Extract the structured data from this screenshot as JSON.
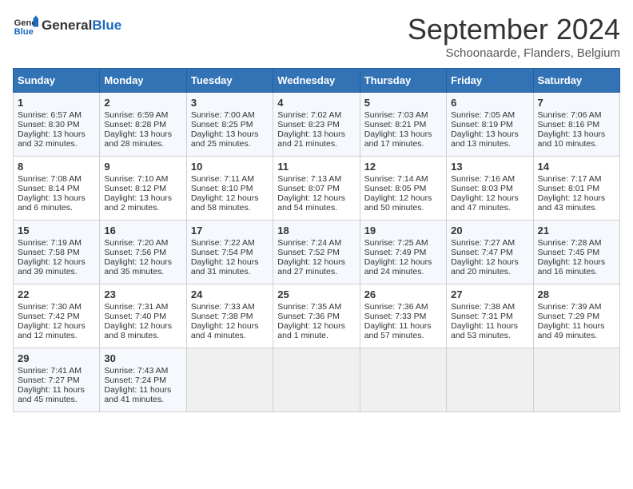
{
  "header": {
    "logo_general": "General",
    "logo_blue": "Blue",
    "month_title": "September 2024",
    "subtitle": "Schoonaarde, Flanders, Belgium"
  },
  "days_of_week": [
    "Sunday",
    "Monday",
    "Tuesday",
    "Wednesday",
    "Thursday",
    "Friday",
    "Saturday"
  ],
  "weeks": [
    [
      {
        "day": 1,
        "sunrise": "Sunrise: 6:57 AM",
        "sunset": "Sunset: 8:30 PM",
        "daylight": "Daylight: 13 hours and 32 minutes."
      },
      {
        "day": 2,
        "sunrise": "Sunrise: 6:59 AM",
        "sunset": "Sunset: 8:28 PM",
        "daylight": "Daylight: 13 hours and 28 minutes."
      },
      {
        "day": 3,
        "sunrise": "Sunrise: 7:00 AM",
        "sunset": "Sunset: 8:25 PM",
        "daylight": "Daylight: 13 hours and 25 minutes."
      },
      {
        "day": 4,
        "sunrise": "Sunrise: 7:02 AM",
        "sunset": "Sunset: 8:23 PM",
        "daylight": "Daylight: 13 hours and 21 minutes."
      },
      {
        "day": 5,
        "sunrise": "Sunrise: 7:03 AM",
        "sunset": "Sunset: 8:21 PM",
        "daylight": "Daylight: 13 hours and 17 minutes."
      },
      {
        "day": 6,
        "sunrise": "Sunrise: 7:05 AM",
        "sunset": "Sunset: 8:19 PM",
        "daylight": "Daylight: 13 hours and 13 minutes."
      },
      {
        "day": 7,
        "sunrise": "Sunrise: 7:06 AM",
        "sunset": "Sunset: 8:16 PM",
        "daylight": "Daylight: 13 hours and 10 minutes."
      }
    ],
    [
      {
        "day": 8,
        "sunrise": "Sunrise: 7:08 AM",
        "sunset": "Sunset: 8:14 PM",
        "daylight": "Daylight: 13 hours and 6 minutes."
      },
      {
        "day": 9,
        "sunrise": "Sunrise: 7:10 AM",
        "sunset": "Sunset: 8:12 PM",
        "daylight": "Daylight: 13 hours and 2 minutes."
      },
      {
        "day": 10,
        "sunrise": "Sunrise: 7:11 AM",
        "sunset": "Sunset: 8:10 PM",
        "daylight": "Daylight: 12 hours and 58 minutes."
      },
      {
        "day": 11,
        "sunrise": "Sunrise: 7:13 AM",
        "sunset": "Sunset: 8:07 PM",
        "daylight": "Daylight: 12 hours and 54 minutes."
      },
      {
        "day": 12,
        "sunrise": "Sunrise: 7:14 AM",
        "sunset": "Sunset: 8:05 PM",
        "daylight": "Daylight: 12 hours and 50 minutes."
      },
      {
        "day": 13,
        "sunrise": "Sunrise: 7:16 AM",
        "sunset": "Sunset: 8:03 PM",
        "daylight": "Daylight: 12 hours and 47 minutes."
      },
      {
        "day": 14,
        "sunrise": "Sunrise: 7:17 AM",
        "sunset": "Sunset: 8:01 PM",
        "daylight": "Daylight: 12 hours and 43 minutes."
      }
    ],
    [
      {
        "day": 15,
        "sunrise": "Sunrise: 7:19 AM",
        "sunset": "Sunset: 7:58 PM",
        "daylight": "Daylight: 12 hours and 39 minutes."
      },
      {
        "day": 16,
        "sunrise": "Sunrise: 7:20 AM",
        "sunset": "Sunset: 7:56 PM",
        "daylight": "Daylight: 12 hours and 35 minutes."
      },
      {
        "day": 17,
        "sunrise": "Sunrise: 7:22 AM",
        "sunset": "Sunset: 7:54 PM",
        "daylight": "Daylight: 12 hours and 31 minutes."
      },
      {
        "day": 18,
        "sunrise": "Sunrise: 7:24 AM",
        "sunset": "Sunset: 7:52 PM",
        "daylight": "Daylight: 12 hours and 27 minutes."
      },
      {
        "day": 19,
        "sunrise": "Sunrise: 7:25 AM",
        "sunset": "Sunset: 7:49 PM",
        "daylight": "Daylight: 12 hours and 24 minutes."
      },
      {
        "day": 20,
        "sunrise": "Sunrise: 7:27 AM",
        "sunset": "Sunset: 7:47 PM",
        "daylight": "Daylight: 12 hours and 20 minutes."
      },
      {
        "day": 21,
        "sunrise": "Sunrise: 7:28 AM",
        "sunset": "Sunset: 7:45 PM",
        "daylight": "Daylight: 12 hours and 16 minutes."
      }
    ],
    [
      {
        "day": 22,
        "sunrise": "Sunrise: 7:30 AM",
        "sunset": "Sunset: 7:42 PM",
        "daylight": "Daylight: 12 hours and 12 minutes."
      },
      {
        "day": 23,
        "sunrise": "Sunrise: 7:31 AM",
        "sunset": "Sunset: 7:40 PM",
        "daylight": "Daylight: 12 hours and 8 minutes."
      },
      {
        "day": 24,
        "sunrise": "Sunrise: 7:33 AM",
        "sunset": "Sunset: 7:38 PM",
        "daylight": "Daylight: 12 hours and 4 minutes."
      },
      {
        "day": 25,
        "sunrise": "Sunrise: 7:35 AM",
        "sunset": "Sunset: 7:36 PM",
        "daylight": "Daylight: 12 hours and 1 minute."
      },
      {
        "day": 26,
        "sunrise": "Sunrise: 7:36 AM",
        "sunset": "Sunset: 7:33 PM",
        "daylight": "Daylight: 11 hours and 57 minutes."
      },
      {
        "day": 27,
        "sunrise": "Sunrise: 7:38 AM",
        "sunset": "Sunset: 7:31 PM",
        "daylight": "Daylight: 11 hours and 53 minutes."
      },
      {
        "day": 28,
        "sunrise": "Sunrise: 7:39 AM",
        "sunset": "Sunset: 7:29 PM",
        "daylight": "Daylight: 11 hours and 49 minutes."
      }
    ],
    [
      {
        "day": 29,
        "sunrise": "Sunrise: 7:41 AM",
        "sunset": "Sunset: 7:27 PM",
        "daylight": "Daylight: 11 hours and 45 minutes."
      },
      {
        "day": 30,
        "sunrise": "Sunrise: 7:43 AM",
        "sunset": "Sunset: 7:24 PM",
        "daylight": "Daylight: 11 hours and 41 minutes."
      },
      null,
      null,
      null,
      null,
      null
    ]
  ]
}
